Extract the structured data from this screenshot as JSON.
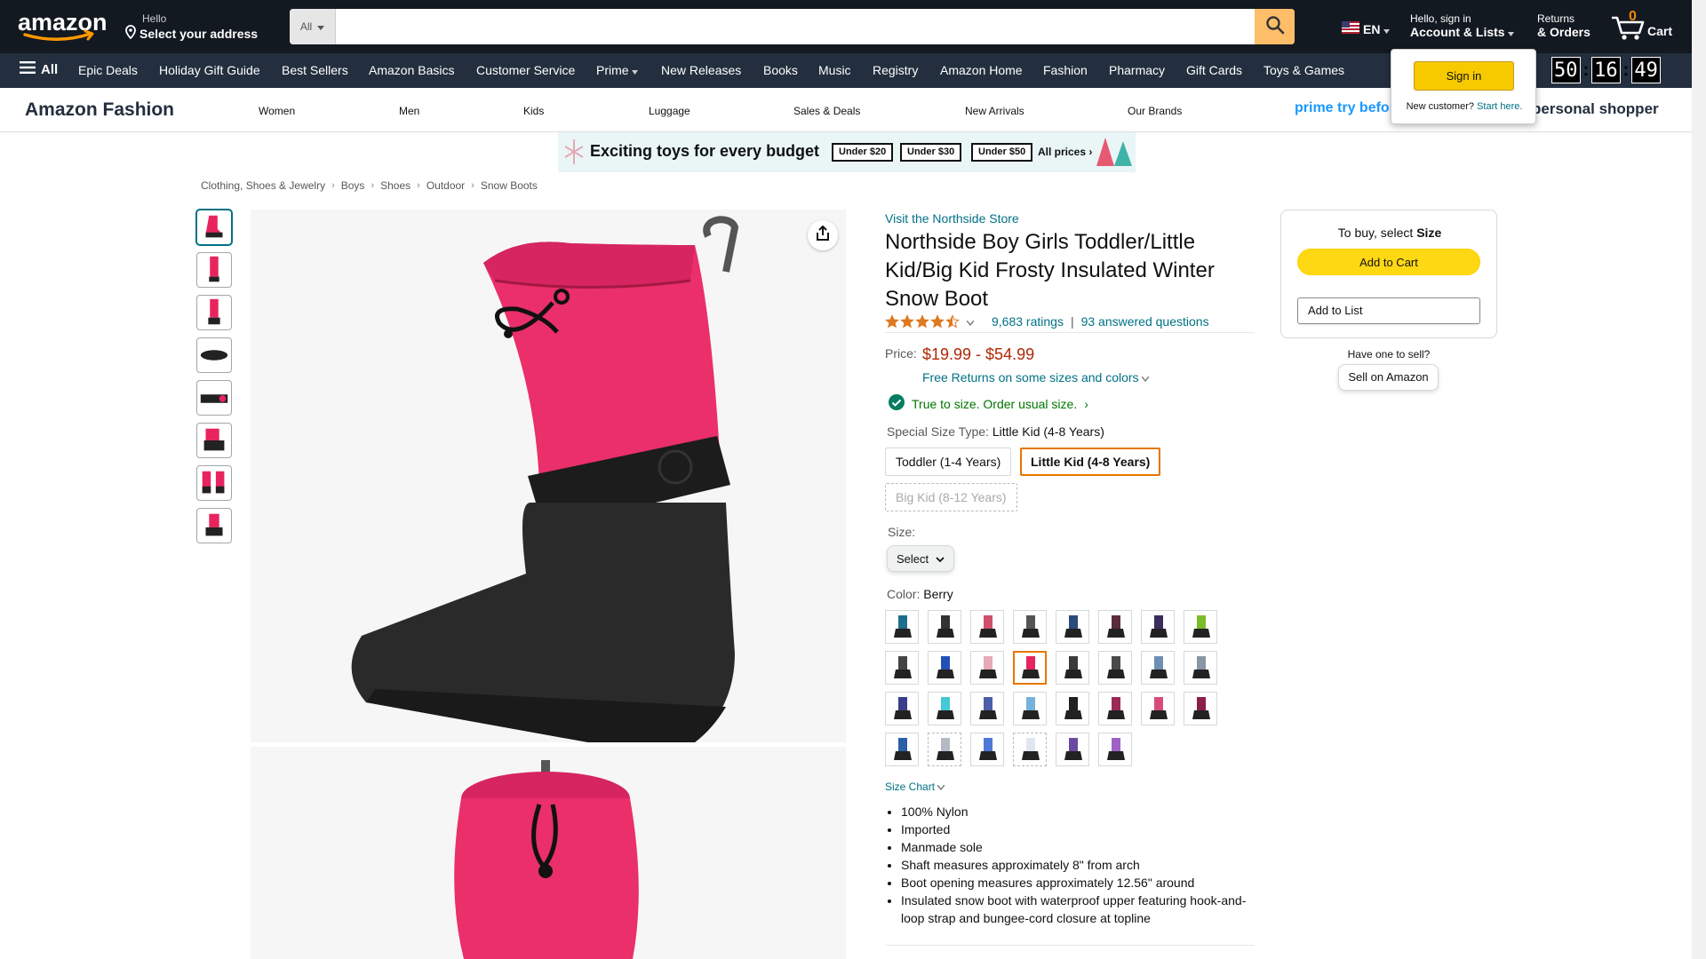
{
  "header": {
    "logo_text": "amazon",
    "deliver_line1": "Hello",
    "deliver_line2": "Select your address",
    "search_category": "All",
    "search_placeholder": "",
    "language": "EN",
    "account_line1": "Hello, sign in",
    "account_line2": "Account & Lists",
    "returns_line1": "Returns",
    "returns_line2": "& Orders",
    "cart_count": "0",
    "cart_label": "Cart"
  },
  "nav": {
    "all_label": "All",
    "items": [
      "Epic Deals",
      "Holiday Gift Guide",
      "Best Sellers",
      "Amazon Basics",
      "Customer Service",
      "Prime",
      "New Releases",
      "Books",
      "Music",
      "Registry",
      "Amazon Home",
      "Fashion",
      "Pharmacy",
      "Gift Cards",
      "Toys & Games"
    ]
  },
  "fashion_bar": {
    "brand": "Amazon Fashion",
    "items": [
      "Women",
      "Men",
      "Kids",
      "Luggage",
      "Sales & Deals",
      "New Arrivals",
      "Our Brands"
    ],
    "promo_right_1": "prime try before",
    "promo_right_2": "personal shopper"
  },
  "promo": {
    "text": "Exciting toys for every budget",
    "tags": [
      "Under $20",
      "Under $30",
      "Under $50"
    ],
    "all_prices": "All prices ›"
  },
  "popover": {
    "signin": "Sign in",
    "new_customer": "New customer?",
    "start_here": "Start here."
  },
  "timer": {
    "h": "50",
    "m": "16",
    "s": "49"
  },
  "breadcrumbs": [
    "Clothing, Shoes & Jewelry",
    "Boys",
    "Shoes",
    "Outdoor",
    "Snow Boots"
  ],
  "product": {
    "store_link": "Visit the Northside Store",
    "title": "Northside Boy Girls Toddler/Little Kid/Big Kid Frosty Insulated Winter Snow Boot",
    "rating_stars": 4.5,
    "ratings_count": "9,683 ratings",
    "answered": "93 answered questions",
    "price_label": "Price:",
    "price": "$19.99 - $54.99",
    "free_returns": "Free Returns on some sizes and colors",
    "fit_text": "True to size. Order usual size.",
    "size_type_label": "Special Size Type:",
    "size_type_value": "Little Kid (4-8 Years)",
    "size_types": [
      {
        "label": "Toddler (1-4 Years)",
        "state": "normal"
      },
      {
        "label": "Little Kid (4-8 Years)",
        "state": "selected"
      },
      {
        "label": "Big Kid (8-12 Years)",
        "state": "disabled"
      }
    ],
    "size_label": "Size:",
    "size_select": "Select",
    "color_label": "Color:",
    "color_value": "Berry",
    "selected_swatch_index": 11,
    "swatches": [
      "#1d6f8c",
      "#333",
      "#d0506b",
      "#555",
      "#2b4b7a",
      "#5a2d3d",
      "#3a2d5c",
      "#7cbb2a",
      "#444",
      "#2250b8",
      "#e8a9b9",
      "#e8245e",
      "#3a3a3a",
      "#4a4a4a",
      "#6c8fb3",
      "#8a96a6",
      "#3b3f8a",
      "#45c9d6",
      "#4c5fa8",
      "#76b2dc",
      "#202020",
      "#9a2a55",
      "#d94a7a",
      "#8a1f4a",
      "#2b5fa6",
      "#b5b9c6",
      "#4d78d6",
      "#dfe6ef",
      "#6a4aa0",
      "#9e62c4"
    ],
    "disabled_swatches": [
      25,
      27
    ],
    "size_chart": "Size Chart",
    "bullets": [
      "100% Nylon",
      "Imported",
      "Manmade sole",
      "Shaft measures approximately 8\" from arch",
      "Boot opening measures approximately 12.56\" around",
      "Insulated snow boot with waterproof upper featuring hook-and-loop strap and bungee-cord closure at topline"
    ]
  },
  "buybox": {
    "hint_prefix": "To buy, select",
    "hint_bold": "Size",
    "add_to_cart": "Add to Cart",
    "add_to_list": "Add to List",
    "have_one": "Have one to sell?",
    "sell_on_amazon": "Sell on Amazon"
  },
  "colors": {
    "header_bg": "#131921",
    "nav_bg": "#232f3e",
    "link": "#007185",
    "price": "#b12704",
    "fit_green": "#007600",
    "add_cart": "#ffd814",
    "selected_border": "#e77600",
    "boot_pink": "#e8245e"
  }
}
